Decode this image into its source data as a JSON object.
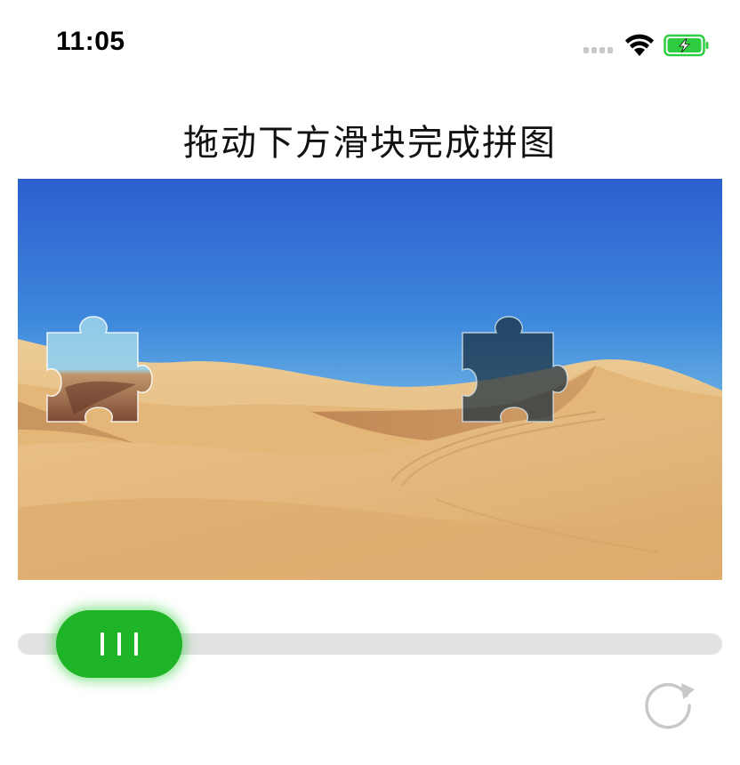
{
  "status_bar": {
    "time": "11:05",
    "signal_icon": "cellular-signal-icon",
    "wifi_icon": "wifi-icon",
    "battery_icon": "battery-charging-icon",
    "battery_color": "#2ecc40"
  },
  "title": "拖动下方滑块完成拼图",
  "puzzle": {
    "image": "desert-dunes-background",
    "piece_icon": "puzzle-piece-icon",
    "target_icon": "puzzle-slot-icon",
    "sky_color": "#3a78d8",
    "sand_color": "#e2b77c"
  },
  "slider": {
    "position": 0.06,
    "thumb_color": "#1fb327",
    "track_color": "#e2e2e2",
    "grip_icon": "slider-grip-icon"
  },
  "refresh": {
    "icon": "refresh-icon",
    "color": "#c8c8c8"
  }
}
